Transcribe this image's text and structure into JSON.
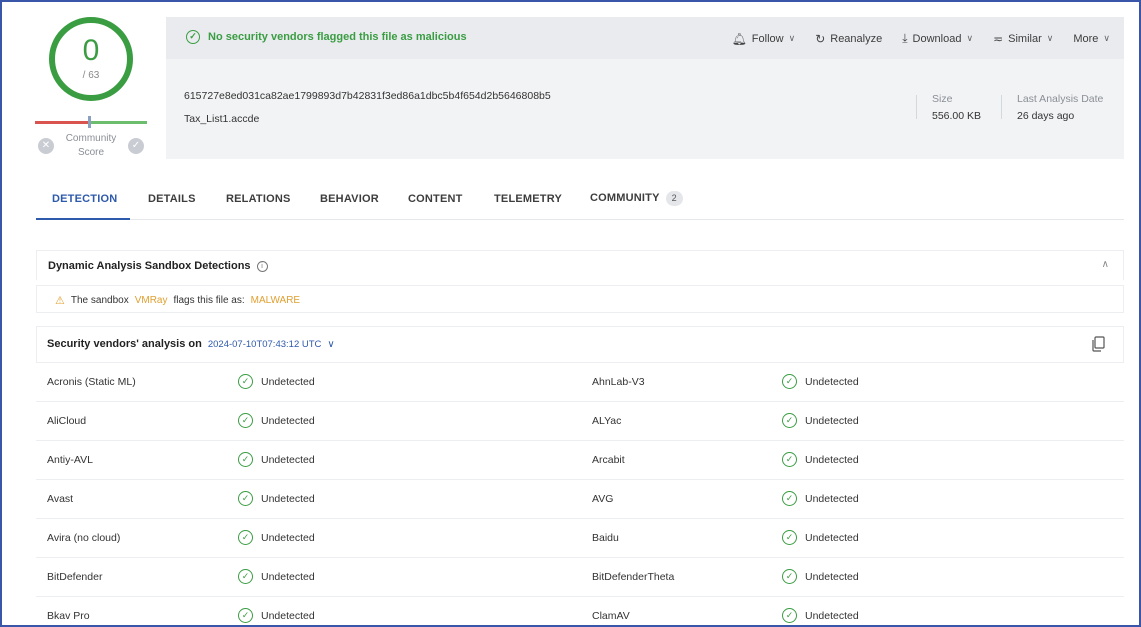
{
  "score": {
    "detected": "0",
    "total": "/ 63",
    "community_label_1": "Community",
    "community_label_2": "Score"
  },
  "header": {
    "verdict": "No security vendors flagged this file as malicious",
    "actions": [
      "Follow",
      "Reanalyze",
      "Download",
      "Similar",
      "More"
    ],
    "hash": "615727e8ed031ca82ae1799893d7b42831f3ed86a1dbc5b4f654d2b5646808b5",
    "filename": "Tax_List1.accde",
    "size_label": "Size",
    "size_value": "556.00 KB",
    "date_label": "Last Analysis Date",
    "date_value": "26 days ago"
  },
  "tabs": [
    {
      "label": "DETECTION"
    },
    {
      "label": "DETAILS"
    },
    {
      "label": "RELATIONS"
    },
    {
      "label": "BEHAVIOR"
    },
    {
      "label": "CONTENT"
    },
    {
      "label": "TELEMETRY"
    },
    {
      "label": "COMMUNITY",
      "badge": "2"
    }
  ],
  "sandbox": {
    "title": "Dynamic Analysis Sandbox Detections",
    "prefix": "The sandbox",
    "vendor": "VMRay",
    "middle": "flags this file as:",
    "verdict": "MALWARE"
  },
  "vendors": {
    "title": "Security vendors' analysis on",
    "date": "2024-07-10T07:43:12 UTC",
    "rows": [
      {
        "left": "Acronis (Static ML)",
        "left_result": "Undetected",
        "right": "AhnLab-V3",
        "right_result": "Undetected"
      },
      {
        "left": "AliCloud",
        "left_result": "Undetected",
        "right": "ALYac",
        "right_result": "Undetected"
      },
      {
        "left": "Antiy-AVL",
        "left_result": "Undetected",
        "right": "Arcabit",
        "right_result": "Undetected"
      },
      {
        "left": "Avast",
        "left_result": "Undetected",
        "right": "AVG",
        "right_result": "Undetected"
      },
      {
        "left": "Avira (no cloud)",
        "left_result": "Undetected",
        "right": "Baidu",
        "right_result": "Undetected"
      },
      {
        "left": "BitDefender",
        "left_result": "Undetected",
        "right": "BitDefenderTheta",
        "right_result": "Undetected"
      },
      {
        "left": "Bkav Pro",
        "left_result": "Undetected",
        "right": "ClamAV",
        "right_result": "Undetected"
      }
    ]
  },
  "colors": {
    "accent": "#2e5aac",
    "clean": "#3a9d42",
    "warning": "#e0a030"
  },
  "icons": [
    "bell-icon",
    "refresh-icon",
    "download-icon",
    "similar-icon",
    "chevron-down-icon",
    "check-circle-icon",
    "info-icon",
    "warning-icon",
    "copy-icon",
    "chevron-up-icon"
  ]
}
